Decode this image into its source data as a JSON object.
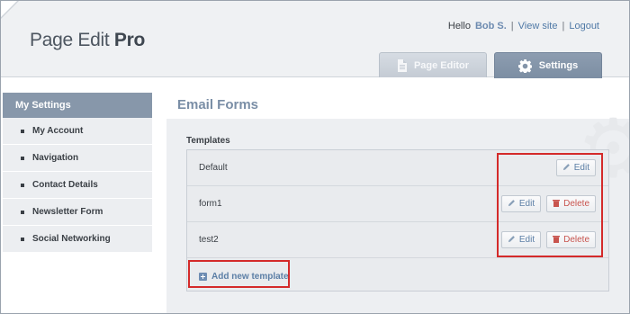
{
  "header": {
    "logo_light": "Page Edit ",
    "logo_bold": "Pro",
    "greeting": "Hello",
    "username": "Bob S.",
    "view_site": "View site",
    "logout": "Logout",
    "sep": "|"
  },
  "tabs": [
    {
      "label": "Page Editor",
      "icon": "document-icon"
    },
    {
      "label": "Settings",
      "icon": "gear-icon"
    }
  ],
  "sidebar": {
    "title": "My Settings",
    "items": [
      {
        "label": "My Account"
      },
      {
        "label": "Navigation"
      },
      {
        "label": "Contact Details"
      },
      {
        "label": "Newsletter Form"
      },
      {
        "label": "Social Networking"
      }
    ]
  },
  "main": {
    "title": "Email Forms",
    "templates_label": "Templates",
    "templates": [
      {
        "name": "Default",
        "edit": "Edit"
      },
      {
        "name": "form1",
        "edit": "Edit",
        "delete": "Delete"
      },
      {
        "name": "test2",
        "edit": "Edit",
        "delete": "Delete"
      }
    ],
    "add_label": "Add new template"
  },
  "colors": {
    "accent": "#8797aa",
    "link": "#5c7fa6",
    "delete": "#c8544e",
    "highlight": "#d42a2a"
  }
}
